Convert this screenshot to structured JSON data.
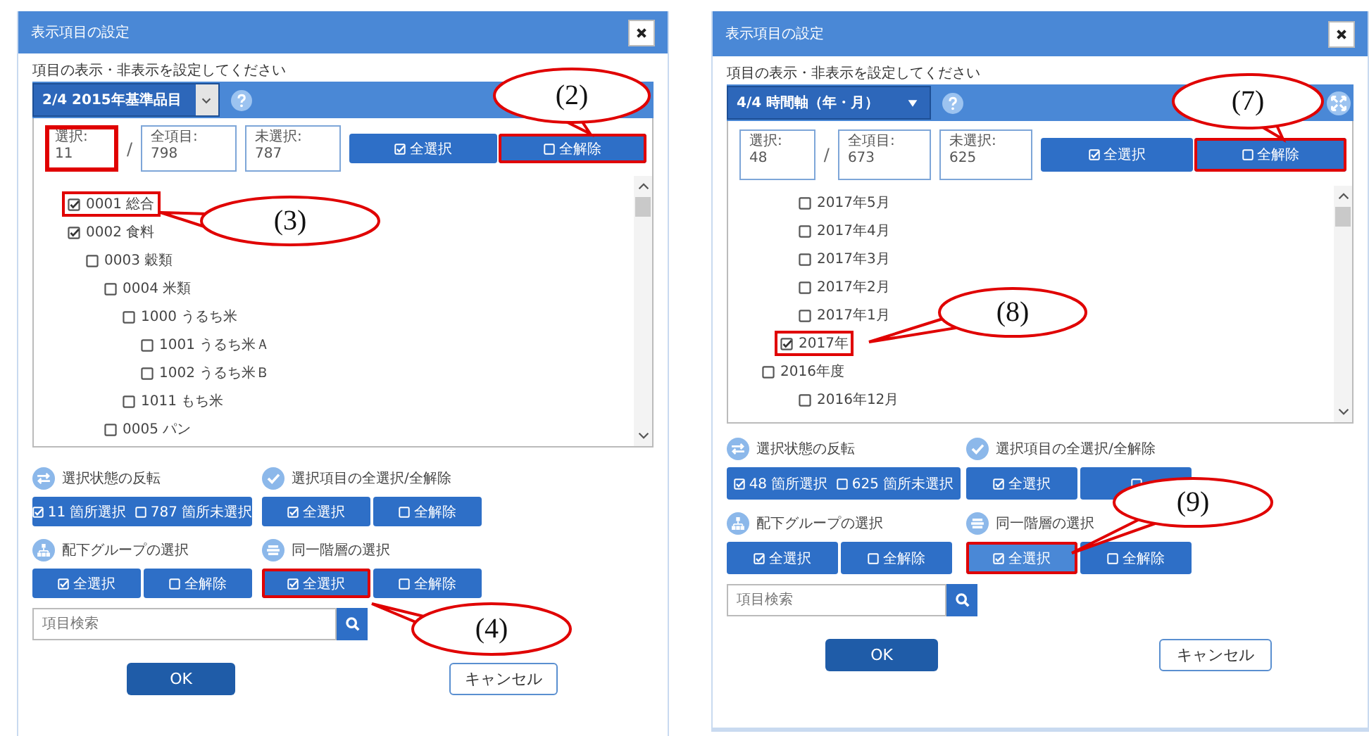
{
  "panels": [
    {
      "title": "表示項目の設定",
      "instruction": "項目の表示・非表示を設定してください",
      "dropdown": {
        "value": "2/4 2015年基準品目",
        "kind": "chevron_box"
      },
      "expand_button": false,
      "counts": [
        {
          "label": "選択:",
          "value": "11",
          "highlighted": true
        },
        {
          "label": "全項目:",
          "value": "798",
          "highlighted": false
        },
        {
          "label": "未選択:",
          "value": "787",
          "highlighted": false
        }
      ],
      "count_separator": "/",
      "top_buttons": [
        {
          "kind": "check",
          "label": "全選択",
          "highlighted": false
        },
        {
          "kind": "clear",
          "label": "全解除",
          "highlighted": true
        }
      ],
      "tree": [
        {
          "label": "0001 総合",
          "checked": true,
          "highlighted": true
        },
        {
          "label": "0002 食料",
          "checked": true,
          "highlighted": false,
          "children": [
            {
              "label": "0003 穀類",
              "checked": false,
              "highlighted": false,
              "children": [
                {
                  "label": "0004 米類",
                  "checked": false,
                  "highlighted": false,
                  "children": [
                    {
                      "label": "1000 うるち米",
                      "checked": false,
                      "highlighted": false,
                      "children": [
                        {
                          "label": "1001 うるち米Ａ",
                          "checked": false,
                          "highlighted": false
                        },
                        {
                          "label": "1002 うるち米Ｂ",
                          "checked": false,
                          "highlighted": false
                        }
                      ]
                    },
                    {
                      "label": "1011 もち米",
                      "checked": false,
                      "highlighted": false
                    }
                  ]
                },
                {
                  "label": "0005 パン",
                  "checked": false,
                  "highlighted": false
                }
              ]
            }
          ]
        }
      ],
      "sections": [
        {
          "kind": "invert",
          "title": "選択状態の反転",
          "buttons": [
            {
              "kind": "invert",
              "selected_text": "11 箇所選択",
              "unselected_text": "787 箇所未選択",
              "highlighted": false
            }
          ]
        },
        {
          "kind": "check",
          "title": "選択項目の全選択/全解除",
          "buttons": [
            {
              "kind": "check",
              "label": "全選択",
              "highlighted": false
            },
            {
              "kind": "clear",
              "label": "全解除",
              "highlighted": false
            }
          ]
        },
        {
          "kind": "group",
          "title": "配下グループの選択",
          "buttons": [
            {
              "kind": "check",
              "label": "全選択",
              "highlighted": false
            },
            {
              "kind": "clear",
              "label": "全解除",
              "highlighted": false
            }
          ]
        },
        {
          "kind": "layer",
          "title": "同一階層の選択",
          "buttons": [
            {
              "kind": "check",
              "label": "全選択",
              "highlighted": true
            },
            {
              "kind": "clear",
              "label": "全解除",
              "highlighted": false
            }
          ]
        }
      ],
      "search": {
        "placeholder": "項目検索"
      },
      "ok": "OK",
      "cancel": "キャンセル",
      "callouts": [
        {
          "text": "(2)"
        },
        {
          "text": "(3)"
        },
        {
          "text": "(4)"
        }
      ]
    },
    {
      "title": "表示項目の設定",
      "instruction": "項目の表示・非表示を設定してください",
      "dropdown": {
        "value": "4/4 時間軸（年・月）",
        "kind": "triangle"
      },
      "expand_button": true,
      "counts": [
        {
          "label": "選択:",
          "value": "48",
          "highlighted": false
        },
        {
          "label": "全項目:",
          "value": "673",
          "highlighted": false
        },
        {
          "label": "未選択:",
          "value": "625",
          "highlighted": false
        }
      ],
      "count_separator": "/",
      "top_buttons": [
        {
          "kind": "check",
          "label": "全選択",
          "highlighted": false
        },
        {
          "kind": "clear",
          "label": "全解除",
          "highlighted": true
        }
      ],
      "tree": [
        {
          "children": [
            {
              "children": [
                {
                  "label": "2017年5月",
                  "checked": false,
                  "highlighted": false
                },
                {
                  "label": "2017年4月",
                  "checked": false,
                  "highlighted": false
                },
                {
                  "label": "2017年3月",
                  "checked": false,
                  "highlighted": false
                },
                {
                  "label": "2017年2月",
                  "checked": false,
                  "highlighted": false
                },
                {
                  "label": "2017年1月",
                  "checked": false,
                  "highlighted": false
                }
              ]
            },
            {
              "label": "2017年",
              "checked": true,
              "highlighted": true
            }
          ]
        },
        {
          "label": "2016年度",
          "checked": false,
          "highlighted": false,
          "children": [
            {
              "children": [
                {
                  "label": "2016年12月",
                  "checked": false,
                  "highlighted": false
                }
              ]
            }
          ]
        }
      ],
      "sections": [
        {
          "kind": "invert",
          "title": "選択状態の反転",
          "buttons": [
            {
              "kind": "invert",
              "selected_text": "48 箇所選択",
              "unselected_text": "625 箇所未選択",
              "highlighted": false
            }
          ]
        },
        {
          "kind": "check",
          "title": "選択項目の全選択/全解除",
          "buttons": [
            {
              "kind": "check",
              "label": "全選択",
              "highlighted": false
            },
            {
              "kind": "clear",
              "highlighted": false
            }
          ]
        },
        {
          "kind": "group",
          "title": "配下グループの選択",
          "buttons": [
            {
              "kind": "check",
              "label": "全選択",
              "highlighted": false
            },
            {
              "kind": "clear",
              "label": "全解除",
              "highlighted": false
            }
          ]
        },
        {
          "kind": "layer",
          "title": "同一階層の選択",
          "buttons": [
            {
              "kind": "check",
              "label": "全選択",
              "highlighted": true
            },
            {
              "kind": "clear",
              "label": "全解除",
              "highlighted": false
            }
          ]
        }
      ],
      "search": {
        "placeholder": "項目検索"
      },
      "ok": "OK",
      "cancel": "キャンセル",
      "callouts": [
        {
          "text": "(7)"
        },
        {
          "text": "(8)"
        },
        {
          "text": "(9)"
        }
      ]
    }
  ]
}
